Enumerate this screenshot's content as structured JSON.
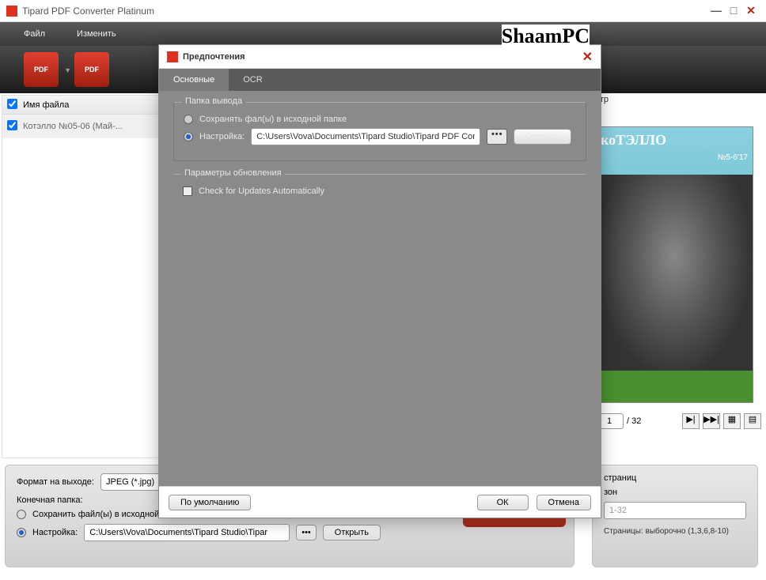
{
  "app": {
    "title": "Tipard PDF Converter Platinum"
  },
  "winbtns": {
    "min": "—",
    "max": "□",
    "close": "✕"
  },
  "menu": {
    "file": "Файл",
    "edit": "Изменить"
  },
  "filelist": {
    "header": "Имя файла",
    "row1": "Котэлло №05-06 (Май-..."
  },
  "preview": {
    "label_tail": "отр",
    "magazine_title": "коТЭЛЛО",
    "issue": "№5-6'17",
    "page_current": "1",
    "page_total": "/ 32"
  },
  "bottom": {
    "format_label": "Формат на выходе:",
    "format_value": "JPEG (*.jpg)",
    "folder_label": "Конечная папка:",
    "save_source": "Сохранить файл(ы) в исходной папке",
    "custom_label": "Настройка:",
    "path": "C:\\Users\\Vova\\Documents\\Tipard Studio\\Tipar",
    "open": "Открыть"
  },
  "right": {
    "pages_label_tail": "страниц",
    "range_label_tail": "зон",
    "range_value": "1-32",
    "pages_hint": "Страницы: выборочно (1,3,6,8-10)"
  },
  "watermark": "ShaamPC",
  "modal": {
    "title": "Предпочтения",
    "tab_main": "Основные",
    "tab_ocr": "OCR",
    "fs_output": "Папка вывода",
    "save_source": "Сохранять фал(ы) в исходной папке",
    "custom_label": "Настройка:",
    "path": "C:\\Users\\Vova\\Documents\\Tipard Studio\\Tipard PDF Converte",
    "open": "Открыть",
    "fs_update": "Параметры обновления",
    "check_updates": "Check for Updates Automatically",
    "default": "По умолчанию",
    "ok": "ОК",
    "cancel": "Отмена"
  }
}
